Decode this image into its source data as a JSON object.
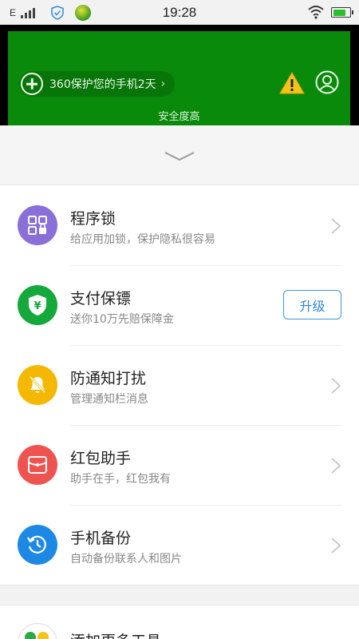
{
  "status_bar": {
    "carrier": "E",
    "time": "19:28",
    "battery_level": 0.8
  },
  "hero": {
    "promo_text": "360保护您的手机2天",
    "promo_chevron": "›",
    "security_status": "安全度高",
    "background_color": "#0a8a0a",
    "icons": [
      "plus-circle-icon",
      "warning-icon",
      "user-icon"
    ]
  },
  "items": [
    {
      "title": "程序锁",
      "subtitle": "给应用加锁，保护隐私很容易",
      "icon": "app-lock-icon",
      "color": "#8a6fd8"
    },
    {
      "title": "支付保镖",
      "subtitle": "送你10万先赔保障金",
      "icon": "payment-shield-icon",
      "color": "#15a83a",
      "action_label": "升级"
    },
    {
      "title": "防通知打扰",
      "subtitle": "管理通知栏消息",
      "icon": "bell-off-icon",
      "color": "#f5b800"
    },
    {
      "title": "红包助手",
      "subtitle": "助手在手，红包我有",
      "icon": "red-packet-icon",
      "color": "#ef5350"
    },
    {
      "title": "手机备份",
      "subtitle": "自动备份联系人和图片",
      "icon": "backup-clock-icon",
      "color": "#1e88e5"
    }
  ],
  "bottom_item": {
    "title": "添加更多工具"
  },
  "colors": {
    "accent_blue": "#2e8ad8"
  }
}
